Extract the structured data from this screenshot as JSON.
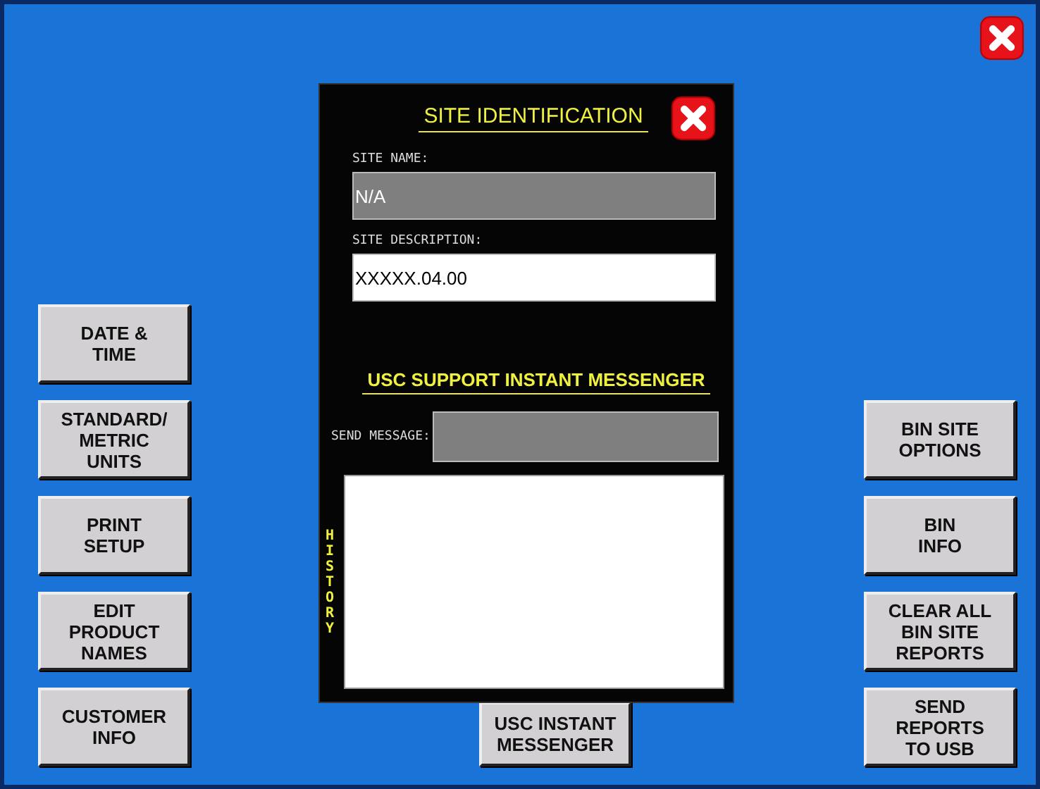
{
  "left_buttons": [
    "DATE &\nTIME",
    "STANDARD/\nMETRIC\nUNITS",
    "PRINT\nSETUP",
    "EDIT\nPRODUCT\nNAMES",
    "CUSTOMER\nINFO"
  ],
  "center_buttons": [
    "USC INSTANT\nMESSENGER"
  ],
  "right_buttons": [
    "BIN SITE\nOPTIONS",
    "BIN\nINFO",
    "CLEAR ALL\nBIN SITE\nREPORTS",
    "SEND\nREPORTS\nTO USB"
  ],
  "dialog": {
    "title": "SITE IDENTIFICATION",
    "site_name": {
      "label": "SITE NAME:",
      "value": "N/A",
      "disabled": true
    },
    "site_description": {
      "label": "SITE DESCRIPTION:",
      "value": "XXXXX.04.00",
      "disabled": false
    },
    "messenger": {
      "title": "USC SUPPORT INSTANT MESSENGER",
      "send_label": "SEND MESSAGE:",
      "history_label": "HISTORY"
    }
  }
}
